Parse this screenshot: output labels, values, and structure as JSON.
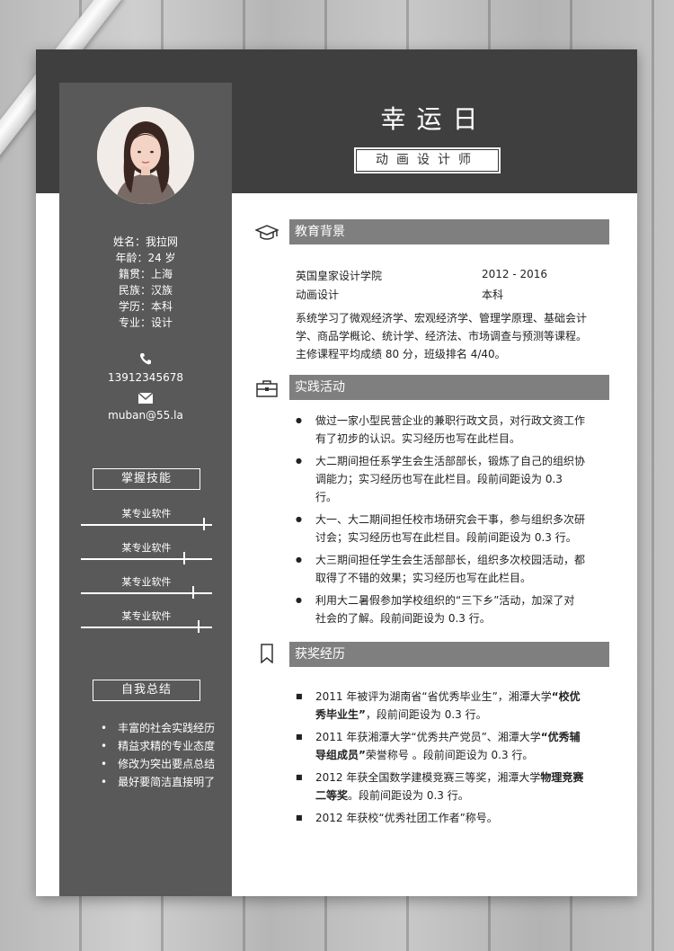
{
  "name": "幸运日",
  "job_title": "动画设计师",
  "profile": {
    "lines": [
      "姓名：我拉网",
      "年龄：24 岁",
      "籍贯：上海",
      "民族：汉族",
      "学历：本科",
      "专业：设计"
    ]
  },
  "contact": {
    "phone": "13912345678",
    "email": "muban@55.la"
  },
  "skills": {
    "title": "掌握技能",
    "items": [
      {
        "label": "某专业软件",
        "level": 0.95
      },
      {
        "label": "某专业软件",
        "level": 0.78
      },
      {
        "label": "某专业软件",
        "level": 0.85
      },
      {
        "label": "某专业软件",
        "level": 0.9
      }
    ]
  },
  "summary": {
    "title": "自我总结",
    "items": [
      "丰富的社会实践经历",
      "精益求精的专业态度",
      "修改为突出要点总结",
      "最好要简洁直接明了"
    ]
  },
  "education": {
    "title": "教育背景",
    "school": "英国皇家设计学院",
    "years": "2012 - 2016",
    "major": "动画设计",
    "degree": "本科",
    "desc1": "系统学习了微观经济学、宏观经济学、管理学原理、基础会计学、商品学概论、统计学、经济法、市场调查与预测等课程。",
    "desc2": "主修课程平均成绩 80 分，班级排名 4/40。"
  },
  "practice": {
    "title": "实践活动",
    "items": [
      "做过一家小型民营企业的兼职行政文员，对行政文资工作有了初步的认识。实习经历也写在此栏目。",
      "大二期间担任系学生会生活部部长，锻炼了自己的组织协调能力；实习经历也写在此栏目。段前间距设为 0.3 行。",
      "大一、大二期间担任校市场研究会干事，参与组织多次研讨会；实习经历也写在此栏目。段前间距设为 0.3 行。",
      "大三期间担任学生会生活部部长，组织多次校园活动，都取得了不错的效果；实习经历也写在此栏目。",
      "利用大二暑假参加学校组织的“三下乡”活动，加深了对社会的了解。段前间距设为 0.3 行。"
    ]
  },
  "awards": {
    "title": "获奖经历",
    "items": [
      {
        "pre": "2011 年被评为湖南省“省优秀毕业生”，湘潭大学",
        "bold": "“校优秀毕业生”",
        "post": "，段前间距设为 0.3 行。"
      },
      {
        "pre": "2011 年获湘潭大学“优秀共产党员”、湘潭大学",
        "bold": "“优秀辅导组成员”",
        "post": "荣誉称号 。段前间距设为 0.3 行。"
      },
      {
        "pre": "2012 年获全国数学建模竞赛三等奖，湘潭大学",
        "bold": "物理竞赛二等奖",
        "post": "。段前间距设为 0.3 行。"
      },
      {
        "pre": "2012 年获校“优秀社团工作者”称号。",
        "bold": "",
        "post": ""
      }
    ]
  },
  "colors": {
    "header": "#3f3f3f",
    "sidebar": "#595959",
    "section_bar": "#7f7f7f"
  }
}
